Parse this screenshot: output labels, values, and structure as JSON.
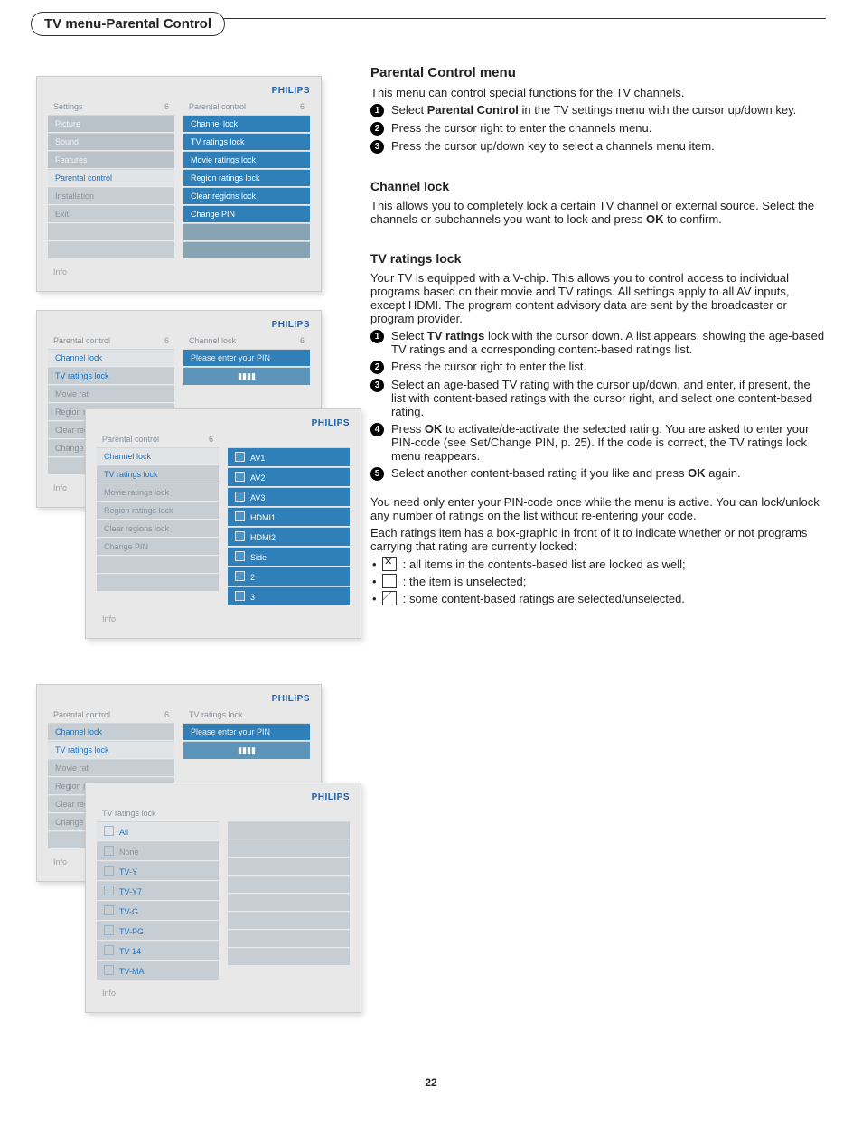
{
  "page_title_chip": "TV menu-Parental Control",
  "right": {
    "h_parental": "Parental Control menu",
    "intro": "This menu can control special functions for the TV channels.",
    "steps_parental": [
      "Select <b>Parental Control</b> in the TV settings menu with the cursor up/down key.",
      "Press the cursor right to enter the channels menu.",
      "Press the cursor up/down key to select a channels menu item."
    ],
    "h_channel": "Channel lock",
    "channel_text": "This allows you to completely lock a certain TV channel or external source. Select the channels or subchannels you want to lock and press <b>OK</b> to confirm.",
    "h_tvratings": "TV ratings lock",
    "tvratings_intro": "Your TV is equipped with a V-chip. This allows you to control access to individual programs based on their movie and TV ratings. All settings apply to all AV inputs, except HDMI. The program content advisory data are sent by the broadcaster or program provider.",
    "steps_tvratings": [
      "Select <b>TV ratings</b> lock with the cursor down. A list appears, showing the age-based TV ratings and a corresponding content-based ratings list.",
      "Press the cursor right to enter the list.",
      "Select an age-based TV rating with the cursor up/down, and enter, if present, the list with content-based ratings with the cursor right, and select one content-based rating.",
      "Press <b>OK</b> to activate/de-activate the selected rating. You are asked to enter your PIN-code (see Set/Change PIN, p. 25). If the code is correct, the TV ratings lock menu reappears.",
      "Select another content-based rating if you like and press <b>OK</b> again."
    ],
    "para1": "You need only enter your PIN-code once while the menu is active. You can lock/unlock any number of ratings on the list without re-entering your code.",
    "para2": "Each ratings item has a box-graphic in front of it to indicate whether or not programs carrying that rating are currently locked:",
    "bullets": [
      ": all items in the contents-based list are locked as well;",
      ": the item is unselected;",
      ": some content-based ratings are selected/unselected."
    ]
  },
  "mock1": {
    "logo": "PHILIPS",
    "left_head": "Settings",
    "left_num": "6",
    "right_head": "Parental control",
    "right_num": "6",
    "left_items": [
      "Picture",
      "Sound",
      "Features",
      "Parental control",
      "Installation",
      "Exit"
    ],
    "right_items": [
      "Channel lock",
      "TV ratings lock",
      "Movie ratings lock",
      "Region ratings lock",
      "Clear regions lock",
      "Change PIN"
    ],
    "info": "Info"
  },
  "mock2a": {
    "logo": "PHILIPS",
    "left_head": "Parental control",
    "left_num": "6",
    "right_head": "Channel lock",
    "right_num": "6",
    "left_items": [
      "Channel lock",
      "TV ratings lock",
      "Movie rat",
      "Region ra",
      "Clear reg",
      "Change P"
    ],
    "right_pin": "Please enter your PIN",
    "info": "Info"
  },
  "mock2b": {
    "logo": "PHILIPS",
    "left_head": "Parental control",
    "left_num": "6",
    "left_items": [
      "Channel lock",
      "TV ratings lock",
      "Movie ratings lock",
      "Region ratings lock",
      "Clear regions lock",
      "Change PIN"
    ],
    "right_items": [
      "AV1",
      "AV2",
      "AV3",
      "HDMI1",
      "HDMI2",
      "Side",
      "2",
      "3"
    ],
    "info": "Info"
  },
  "mock3a": {
    "logo": "PHILIPS",
    "left_head": "Parental control",
    "left_num": "6",
    "right_head": "TV ratings lock",
    "left_items": [
      "Channel lock",
      "TV ratings lock",
      "Movie rat",
      "Region ra",
      "Clear reg",
      "Change P"
    ],
    "right_pin": "Please enter your PIN",
    "info": "Info"
  },
  "mock3b": {
    "logo": "PHILIPS",
    "left_head": "TV ratings lock",
    "left_items": [
      "All",
      "None",
      "TV-Y",
      "TV-Y7",
      "TV-G",
      "TV-PG",
      "TV-14",
      "TV-MA"
    ],
    "info": "Info"
  },
  "page_number": "22"
}
